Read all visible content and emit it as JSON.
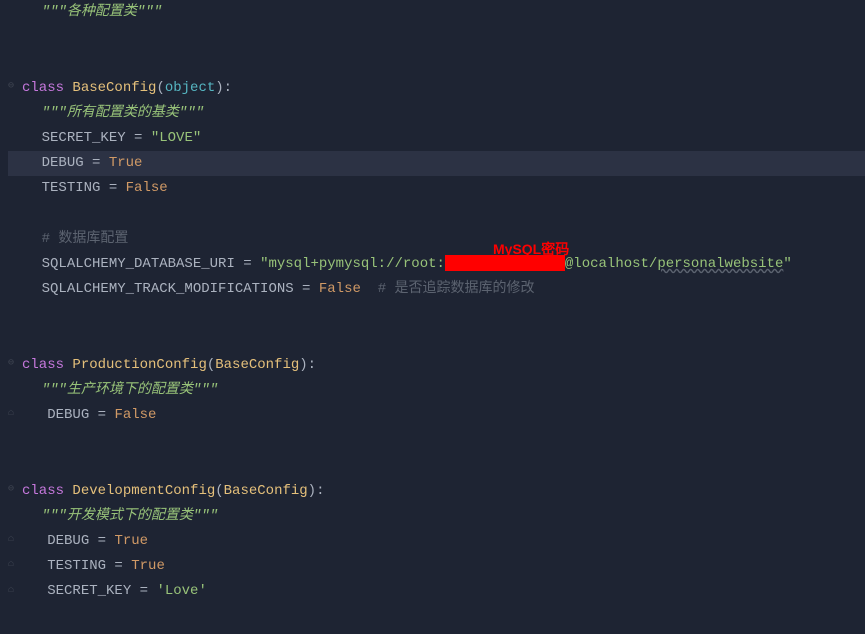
{
  "lines": {
    "l1_docstring": "\"\"\"各种配置类\"\"\"",
    "l4_class": "class",
    "l4_classname": "BaseConfig",
    "l4_param": "object",
    "l5_docstring": "\"\"\"所有配置类的基类\"\"\"",
    "l6_var": "SECRET_KEY",
    "l6_eq": " = ",
    "l6_val": "\"LOVE\"",
    "l7_var": "DEBUG",
    "l7_eq": " = ",
    "l7_val": "True",
    "l8_var": "TESTING",
    "l8_eq": " = ",
    "l8_val": "False",
    "l10_comment": "# 数据库配置",
    "l11_var": "SQLALCHEMY_DATABASE_URI",
    "l11_eq": " = ",
    "l11_str1": "\"mysql+pymysql://root:",
    "l11_str2": "@localhost/",
    "l11_str3": "personalwebsite",
    "l11_str4": "\"",
    "l12_var": "SQLALCHEMY_TRACK_MODIFICATIONS",
    "l12_eq": " = ",
    "l12_val": "False",
    "l12_comment": "  # 是否追踪数据库的修改",
    "l15_class": "class",
    "l15_classname": "ProductionConfig",
    "l15_param": "BaseConfig",
    "l16_docstring": "\"\"\"生产环境下的配置类\"\"\"",
    "l17_var": "DEBUG",
    "l17_eq": " = ",
    "l17_val": "False",
    "l20_class": "class",
    "l20_classname": "DevelopmentConfig",
    "l20_param": "BaseConfig",
    "l21_docstring": "\"\"\"开发模式下的配置类\"\"\"",
    "l22_var": "DEBUG",
    "l22_eq": " = ",
    "l22_val": "True",
    "l23_var": "TESTING",
    "l23_eq": " = ",
    "l23_val": "True",
    "l24_var": "SECRET_KEY",
    "l24_eq": " = ",
    "l24_val": "'Love'"
  },
  "annotation": {
    "mysql_password": "MySQL密码"
  }
}
